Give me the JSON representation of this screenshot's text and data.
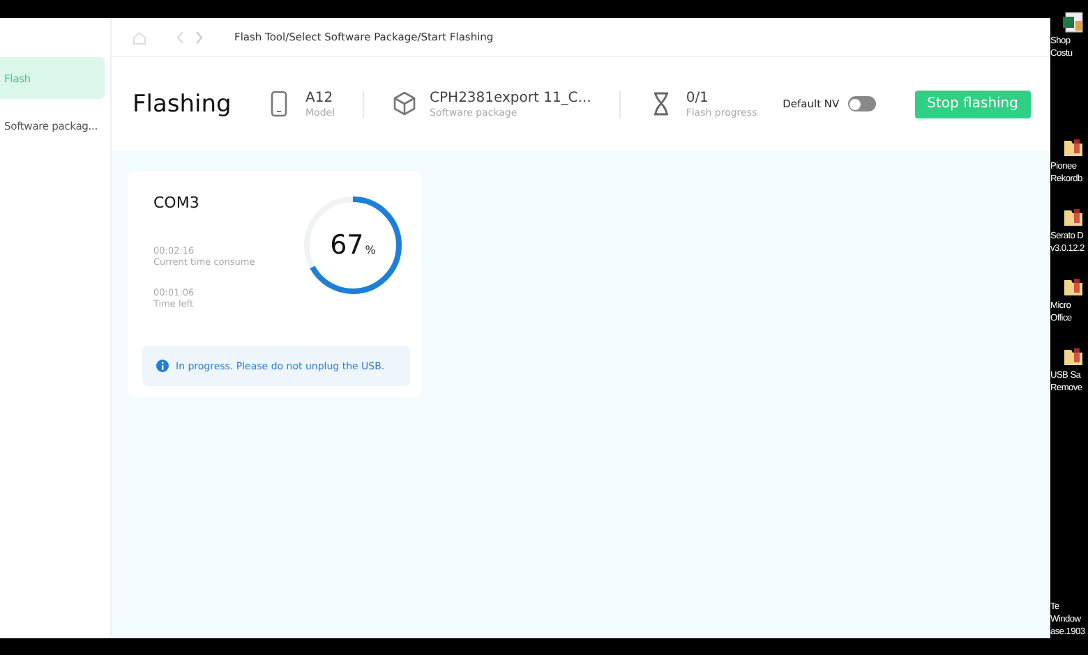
{
  "sidebar": {
    "items": [
      {
        "label": "Flash",
        "selected": true
      },
      {
        "label": "Software packag...",
        "selected": false
      }
    ]
  },
  "breadcrumb": "Flash Tool/Select Software Package/Start Flashing",
  "header": {
    "title": "Flashing",
    "stats": [
      {
        "kind": "phone",
        "value": "A12",
        "label": "Model"
      },
      {
        "kind": "package",
        "value": "CPH2381export 11_C...",
        "label": "Software package"
      },
      {
        "kind": "progress",
        "value": "0/1",
        "label": "Flash progress"
      }
    ],
    "default_nv": {
      "label": "Default NV",
      "on": false
    },
    "stop_button": "Stop flashing"
  },
  "ports": [
    {
      "name": "COM3",
      "level": 0.67,
      "percent": "67",
      "unit": "%",
      "times": [
        {
          "value": "00:02:16",
          "label": "Current time consume"
        },
        {
          "value": "00:01:06",
          "label": "Time left"
        }
      ],
      "message": "In progress. Please do not unplug the USB."
    }
  ],
  "desktop_icons": [
    {
      "kind": "sheet",
      "lines": [
        "Shop",
        "Costu"
      ]
    },
    {
      "kind": "folder",
      "lines": [
        "Pionee",
        "Rekordb"
      ]
    },
    {
      "kind": "folder",
      "lines": [
        "Serato D",
        "v3.0.12.2"
      ]
    },
    {
      "kind": "folder",
      "lines": [
        "Micro",
        "Office"
      ]
    },
    {
      "kind": "folder",
      "lines": [
        "USB Sa",
        "Remove"
      ]
    },
    {
      "kind": "text",
      "lines": [
        "Te",
        "Window",
        "ase.1903"
      ]
    }
  ]
}
